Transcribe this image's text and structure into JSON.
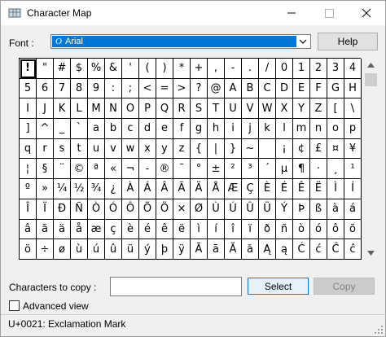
{
  "window": {
    "title": "Character Map",
    "icon": "character-map-app-icon"
  },
  "font": {
    "label": "Font :",
    "selected": "Arial",
    "type_glyph": "O"
  },
  "buttons": {
    "help": "Help",
    "select": "Select",
    "copy": "Copy"
  },
  "copy_field": {
    "label": "Characters to copy :",
    "value": ""
  },
  "advanced_view": {
    "label": "Advanced view",
    "checked": false
  },
  "status": {
    "text": "U+0021: Exclamation Mark"
  },
  "grid": {
    "selected_index": 0,
    "rows": [
      [
        "!",
        "\"",
        "#",
        "$",
        "%",
        "&",
        "'",
        "(",
        ")",
        "*",
        "+",
        ",",
        "-",
        ".",
        "/",
        "0",
        "1",
        "2",
        "3",
        "4"
      ],
      [
        "5",
        "6",
        "7",
        "8",
        "9",
        ":",
        ";",
        "<",
        "=",
        ">",
        "?",
        "@",
        "A",
        "B",
        "C",
        "D",
        "E",
        "F",
        "G",
        "H"
      ],
      [
        "I",
        "J",
        "K",
        "L",
        "M",
        "N",
        "O",
        "P",
        "Q",
        "R",
        "S",
        "T",
        "U",
        "V",
        "W",
        "X",
        "Y",
        "Z",
        "[",
        "\\"
      ],
      [
        "]",
        "^",
        "_",
        "`",
        "a",
        "b",
        "c",
        "d",
        "e",
        "f",
        "g",
        "h",
        "i",
        "j",
        "k",
        "l",
        "m",
        "n",
        "o",
        "p"
      ],
      [
        "q",
        "r",
        "s",
        "t",
        "u",
        "v",
        "w",
        "x",
        "y",
        "z",
        "{",
        "|",
        "}",
        "~",
        "",
        "¡",
        "¢",
        "£",
        "¤",
        "¥"
      ],
      [
        "¦",
        "§",
        "¨",
        "©",
        "ª",
        "«",
        "¬",
        "-",
        "®",
        "¯",
        "°",
        "±",
        "²",
        "³",
        "´",
        "µ",
        "¶",
        "·",
        "¸",
        "¹"
      ],
      [
        "º",
        "»",
        "¼",
        "½",
        "¾",
        "¿",
        "À",
        "Á",
        "Â",
        "Ã",
        "Ä",
        "Å",
        "Æ",
        "Ç",
        "È",
        "É",
        "Ê",
        "Ë",
        "Ì",
        "Í"
      ],
      [
        "Î",
        "Ï",
        "Ð",
        "Ñ",
        "Ò",
        "Ó",
        "Ô",
        "Õ",
        "Ö",
        "×",
        "Ø",
        "Ù",
        "Ú",
        "Û",
        "Ü",
        "Ý",
        "Þ",
        "ß",
        "à",
        "á"
      ],
      [
        "â",
        "ã",
        "ä",
        "å",
        "æ",
        "ç",
        "è",
        "é",
        "ê",
        "ë",
        "ì",
        "í",
        "î",
        "ï",
        "ð",
        "ñ",
        "ò",
        "ó",
        "ô",
        "õ"
      ],
      [
        "ö",
        "÷",
        "ø",
        "ù",
        "ú",
        "û",
        "ü",
        "ý",
        "þ",
        "ÿ",
        "Ā",
        "ā",
        "Ă",
        "ă",
        "Ą",
        "ą",
        "Ć",
        "ć",
        "Ĉ",
        "ĉ"
      ]
    ]
  },
  "colors": {
    "accent": "#0078d7",
    "window_bg": "#f0f0f0"
  }
}
